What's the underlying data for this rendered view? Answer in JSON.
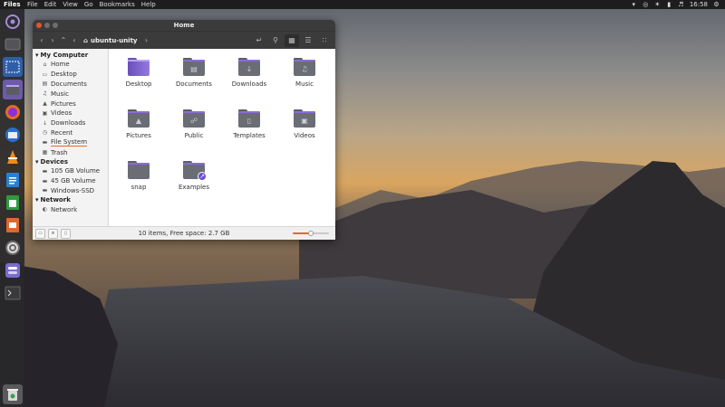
{
  "top_panel": {
    "app_name": "Files",
    "menus": [
      "File",
      "Edit",
      "View",
      "Go",
      "Bookmarks",
      "Help"
    ],
    "clock": "16:58"
  },
  "window": {
    "title": "Home",
    "path_label": "ubuntu-unity"
  },
  "sidebar": {
    "sections": [
      {
        "header": "My Computer",
        "items": [
          {
            "label": "Home",
            "icon": "home-icon"
          },
          {
            "label": "Desktop",
            "icon": "desktop-icon"
          },
          {
            "label": "Documents",
            "icon": "document-icon"
          },
          {
            "label": "Music",
            "icon": "music-icon"
          },
          {
            "label": "Pictures",
            "icon": "picture-icon"
          },
          {
            "label": "Videos",
            "icon": "video-icon"
          },
          {
            "label": "Downloads",
            "icon": "download-icon"
          },
          {
            "label": "Recent",
            "icon": "clock-icon"
          },
          {
            "label": "File System",
            "icon": "drive-icon"
          },
          {
            "label": "Trash",
            "icon": "trash-icon"
          }
        ]
      },
      {
        "header": "Devices",
        "items": [
          {
            "label": "105 GB Volume",
            "icon": "drive-icon"
          },
          {
            "label": "45 GB Volume",
            "icon": "drive-icon"
          },
          {
            "label": "Windows-SSD",
            "icon": "drive-icon"
          }
        ]
      },
      {
        "header": "Network",
        "items": [
          {
            "label": "Network",
            "icon": "network-icon"
          }
        ]
      }
    ]
  },
  "files": [
    {
      "name": "Desktop",
      "icon": "desktop-folder-icon"
    },
    {
      "name": "Documents",
      "icon": "documents-folder-icon"
    },
    {
      "name": "Downloads",
      "icon": "downloads-folder-icon"
    },
    {
      "name": "Music",
      "icon": "music-folder-icon"
    },
    {
      "name": "Pictures",
      "icon": "pictures-folder-icon"
    },
    {
      "name": "Public",
      "icon": "public-folder-icon"
    },
    {
      "name": "Templates",
      "icon": "templates-folder-icon"
    },
    {
      "name": "Videos",
      "icon": "videos-folder-icon"
    },
    {
      "name": "snap",
      "icon": "folder-icon"
    },
    {
      "name": "Examples",
      "icon": "link-folder-icon"
    }
  ],
  "status": {
    "text": "10 items, Free space: 2.7 GB",
    "zoom_level": 0.5
  },
  "colors": {
    "accent": "#e06b2c",
    "folder_purple": "#8a6cd6",
    "titlebar": "#3b3b3b"
  }
}
